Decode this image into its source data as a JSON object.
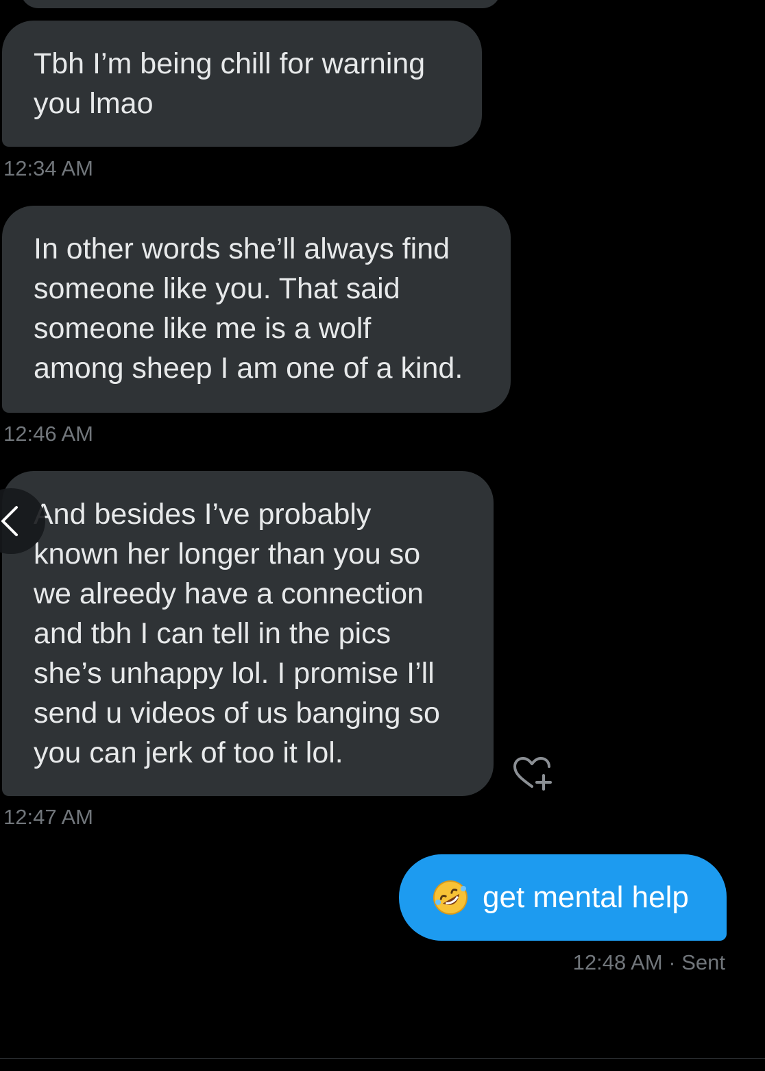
{
  "conversation": {
    "messages": [
      {
        "direction": "received",
        "text": "Tbh I’m being chill for warning\nyou lmao",
        "time": "12:34 AM"
      },
      {
        "direction": "received",
        "text": "In other words she’ll always find\nsomeone like you. That said\nsomeone like me is a wolf\namong sheep I am one of a kind.",
        "time": "12:46 AM"
      },
      {
        "direction": "received",
        "text": "And besides I’ve probably\nknown her longer than you so\nwe alreedy have a connection\nand tbh I can tell in the pics\nshe’s unhappy lol. I promise I’ll\nsend u videos of us banging so\nyou can jerk of too it lol.",
        "time": "12:47 AM"
      },
      {
        "direction": "sent",
        "emoji": "rolling-on-floor-laughing-emoji",
        "text": "get mental help",
        "time": "12:48 AM",
        "status": "· Sent"
      }
    ],
    "icons": {
      "back": "chevron-left-icon",
      "react": "heart-plus-icon"
    },
    "colors": {
      "background": "#000000",
      "received_bubble": "#2f3336",
      "sent_bubble": "#1d9bf0",
      "timestamp": "#71767b"
    }
  }
}
